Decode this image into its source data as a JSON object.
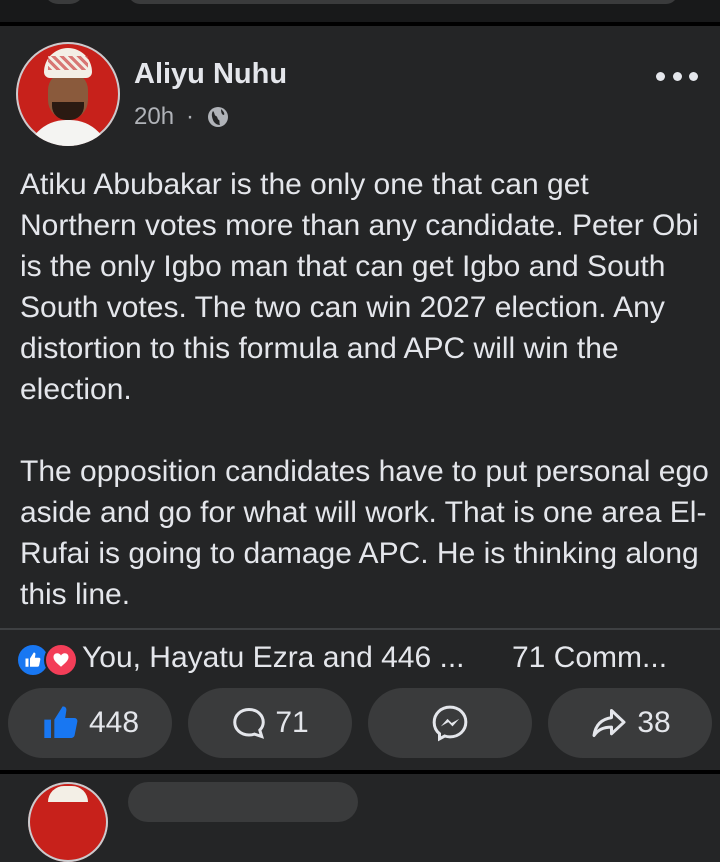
{
  "post": {
    "author": "Aliyu Nuhu",
    "time": "20h",
    "separator": "·",
    "privacy_icon": "globe-icon",
    "more_icon": "more-options-icon",
    "paragraphs": [
      "Atiku Abubakar is the only one that can get Northern votes more than any candidate. Peter Obi is the only Igbo man that can get Igbo and South South votes. The two can win 2027 election. Any distortion to this formula and APC will win the election.",
      "The opposition candidates have to put personal ego aside and go for what will work. That is one area El-Rufai is going to damage APC. He is thinking along this line."
    ]
  },
  "reactions": {
    "summary": "You, Hayatu Ezra and 446 ...",
    "comments": "71 Comm...",
    "icons": [
      "like-icon",
      "love-icon"
    ]
  },
  "actions": {
    "like_count": "448",
    "comment_count": "71",
    "share_count": "38"
  },
  "colors": {
    "background": "#242526",
    "text": "#e4e6eb",
    "secondary_text": "#b0b3b8",
    "button_bg": "#3a3b3c",
    "like_blue": "#1877f2",
    "love_red": "#f33e58"
  }
}
